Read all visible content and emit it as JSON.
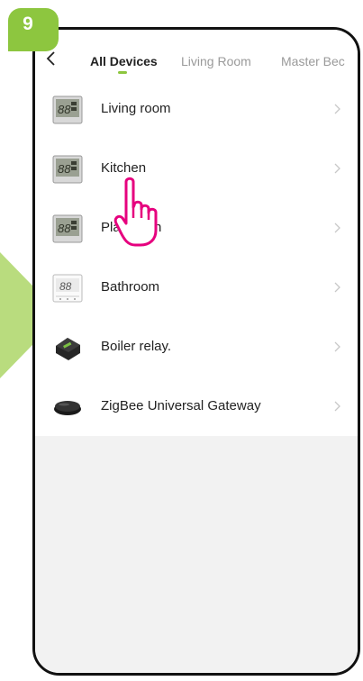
{
  "step": {
    "number": "9"
  },
  "tabs": [
    {
      "label": "All Devices",
      "active": true
    },
    {
      "label": "Living Room",
      "active": false
    },
    {
      "label": "Master Bec",
      "active": false
    }
  ],
  "devices": [
    {
      "label": "Living room",
      "icon": "lcd-thermostat-icon"
    },
    {
      "label": "Kitchen",
      "icon": "lcd-thermostat-icon"
    },
    {
      "label": "Pla",
      "label_tail": "n",
      "icon": "lcd-thermostat-icon"
    },
    {
      "label": "Bathroom",
      "icon": "wall-thermostat-icon"
    },
    {
      "label": "Boiler relay.",
      "icon": "boiler-relay-icon"
    },
    {
      "label": "ZigBee Universal Gateway",
      "icon": "gateway-icon"
    }
  ],
  "colors": {
    "accent": "#8dc63f",
    "pointer": "#e6007e",
    "background_gray": "#f2f2f2"
  }
}
